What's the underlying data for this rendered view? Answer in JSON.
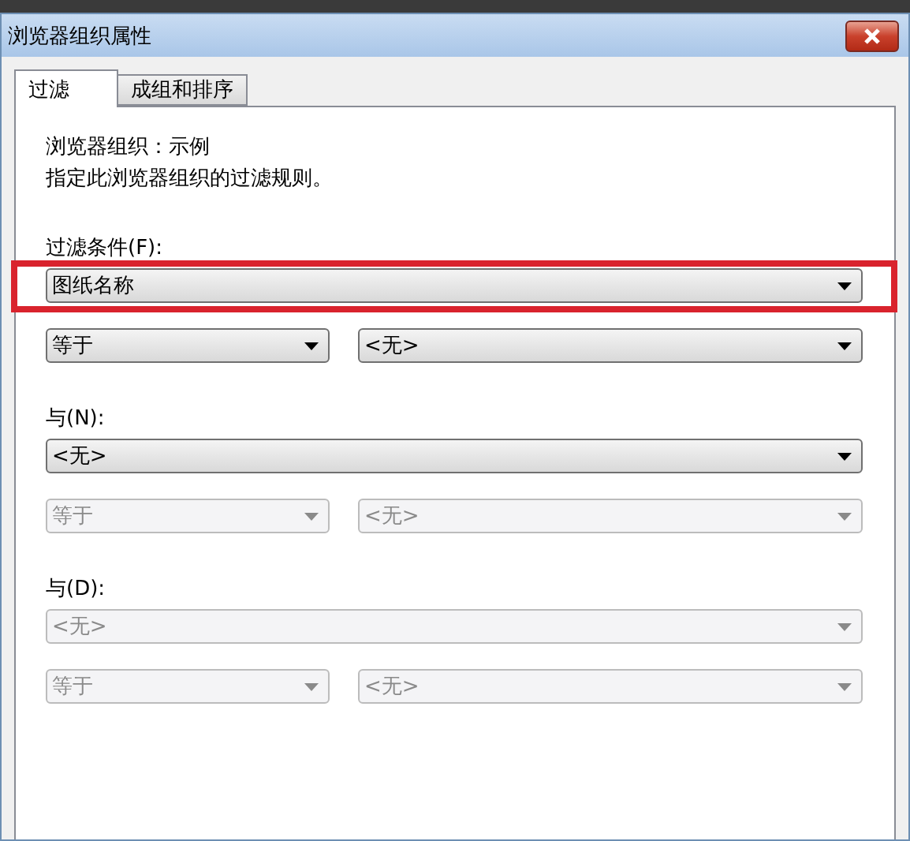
{
  "window": {
    "title": "浏览器组织属性"
  },
  "tabs": [
    {
      "label": "过滤",
      "selected": true
    },
    {
      "label": "成组和排序",
      "selected": false
    }
  ],
  "description": [
    "浏览器组织：示例",
    "指定此浏览器组织的过滤规则。"
  ],
  "conditions": [
    {
      "label": "过滤条件(F):",
      "highlighted": true,
      "field": {
        "value": "图纸名称",
        "disabled": false
      },
      "operator": {
        "value": "等于",
        "disabled": false
      },
      "operand": {
        "value": "<无>",
        "disabled": false
      }
    },
    {
      "label": "与(N):",
      "highlighted": false,
      "field": {
        "value": "<无>",
        "disabled": false
      },
      "operator": {
        "value": "等于",
        "disabled": true
      },
      "operand": {
        "value": "<无>",
        "disabled": true
      }
    },
    {
      "label": "与(D):",
      "highlighted": false,
      "field": {
        "value": "<无>",
        "disabled": true
      },
      "operator": {
        "value": "等于",
        "disabled": true
      },
      "operand": {
        "value": "<无>",
        "disabled": true
      }
    }
  ]
}
